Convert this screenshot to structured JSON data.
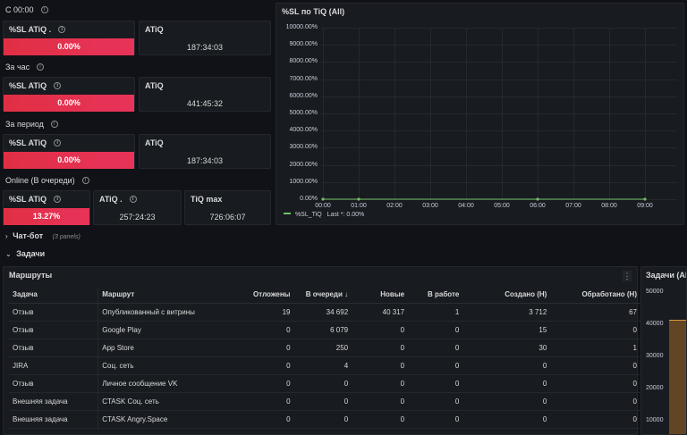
{
  "sections": {
    "c0000": "С 00:00",
    "hour": "За час",
    "period": "За период",
    "online": "Online (В очереди)",
    "chatbot": "Чат-бот",
    "chatbot_note": "(3 panels)",
    "tasks": "Задачи"
  },
  "stats": {
    "row1": {
      "sl_title": "%SL ATiQ .",
      "sl_value": "0.00%",
      "atiq_title": "ATiQ",
      "atiq_value": "187:34:03"
    },
    "row2": {
      "sl_title": "%SL ATiQ",
      "sl_value": "0.00%",
      "atiq_title": "ATiQ",
      "atiq_value": "441:45:32"
    },
    "row3": {
      "sl_title": "%SL ATiQ",
      "sl_value": "0.00%",
      "atiq_title": "ATiQ",
      "atiq_value": "187:34:03"
    },
    "row4": {
      "sl_title": "%SL ATiQ",
      "sl_value": "13.27%",
      "sl_fill": 1.0,
      "atiq_title": "ATiQ .",
      "atiq_value": "257:24:23",
      "tiqmax_title": "TiQ max",
      "tiqmax_value": "726:06:07"
    }
  },
  "chart_data": {
    "type": "line",
    "title": "%SL по TiQ (All)",
    "x": [
      "00:00",
      "01:00",
      "02:00",
      "03:00",
      "04:00",
      "05:00",
      "06:00",
      "07:00",
      "08:00",
      "09:00"
    ],
    "y_ticks": [
      "10000.00%",
      "9000.00%",
      "8000.00%",
      "7000.00%",
      "6000.00%",
      "5000.00%",
      "4000.00%",
      "3000.00%",
      "2000.00%",
      "1000.00%",
      "0.00%"
    ],
    "ylim": [
      0,
      10000
    ],
    "series": [
      {
        "name": "%SL_TiQ",
        "values": [
          0,
          0,
          0,
          0,
          0,
          0,
          0,
          0,
          0,
          0
        ],
        "color": "#73bf69"
      }
    ],
    "legend_last": "Last *: 0.00%",
    "legend": "bottom-left",
    "grid": true
  },
  "routes": {
    "title": "Маршруты",
    "kebab": "⋮",
    "columns": [
      "Задача",
      "Маршрут",
      "Отложены",
      "В очереди ↓",
      "Новые",
      "В работе",
      "Создано (Н)",
      "Обработано (Н)"
    ],
    "rows": [
      [
        "Отзыв",
        "Опубликованный с витрины",
        "19",
        "34 692",
        "40 317",
        "1",
        "3 712",
        "67"
      ],
      [
        "Отзыв",
        "Google Play",
        "0",
        "6 079",
        "0",
        "0",
        "15",
        "0"
      ],
      [
        "Отзыв",
        "App Store",
        "0",
        "250",
        "0",
        "0",
        "30",
        "1"
      ],
      [
        "JIRA",
        "Соц. сеть",
        "0",
        "4",
        "0",
        "0",
        "0",
        "0"
      ],
      [
        "Отзыв",
        "Личное сообщение VK",
        "0",
        "0",
        "0",
        "0",
        "0",
        "0"
      ],
      [
        "Внешняя задача",
        "CTASK Соц. сеть",
        "0",
        "0",
        "0",
        "0",
        "0",
        "0"
      ],
      [
        "Внешняя задача",
        "CTASK Angry.Space",
        "0",
        "0",
        "0",
        "0",
        "0",
        "0"
      ]
    ]
  },
  "tasks_chart": {
    "title": "Задачи (All)",
    "y_ticks": [
      "50000",
      "40000",
      "30000",
      "20000",
      "10000"
    ]
  },
  "colors": {
    "bg": "#111217",
    "panel": "#181b1f",
    "red": "#e02f44",
    "green": "#73bf69"
  }
}
